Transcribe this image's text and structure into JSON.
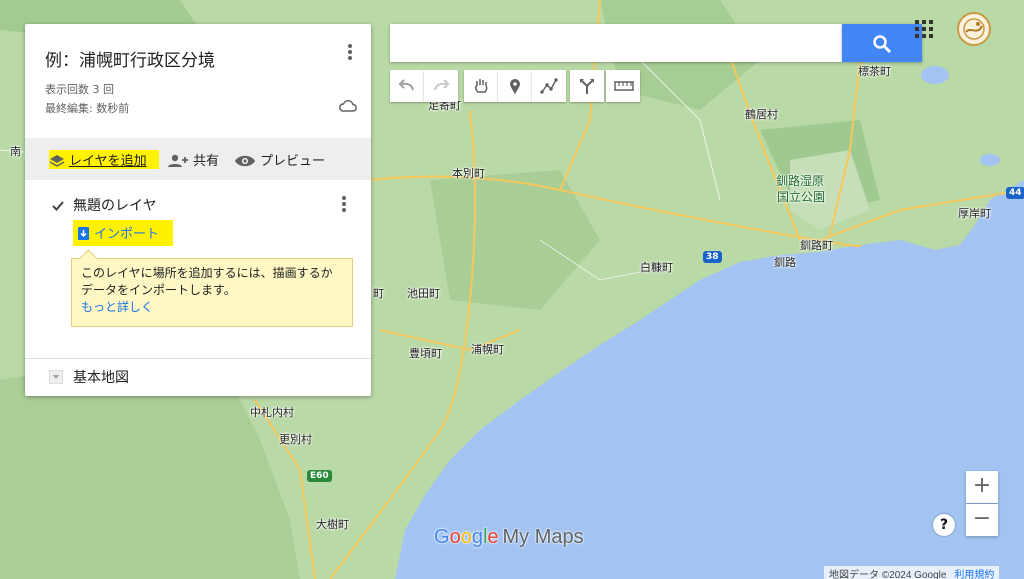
{
  "colors": {
    "sea": "#a3c4f3",
    "land": "#b9d9a6",
    "forest": "#9fcb8e",
    "road": "#f6c75a",
    "accent": "#4285f4",
    "highlight": "#fff200"
  },
  "map": {
    "places": [
      "標茶町",
      "鶴居村",
      "釧路湿原",
      "国立公園",
      "厚岸町",
      "釧路町",
      "釧路",
      "白糠町",
      "本別町",
      "足寄町",
      "池田町",
      "豊頃町",
      "浦幌町",
      "中札内村",
      "更別村",
      "大樹町",
      "南",
      "町"
    ],
    "route_shields": [
      "44",
      "38",
      "E60"
    ]
  },
  "panel": {
    "title": "例：浦幌町行政区分境",
    "views": "表示回数 3 回",
    "edited": "最終編集: 数秒前",
    "actions": {
      "add_layer": "レイヤを追加",
      "share": "共有",
      "preview": "プレビュー"
    },
    "layer": {
      "name": "無題のレイヤ",
      "checked": true,
      "import_label": "インポート"
    },
    "tip": {
      "text": "このレイヤに場所を追加するには、描画するかデータをインポートします。",
      "link": "もっと詳しく"
    },
    "basemap": "基本地図"
  },
  "search": {
    "placeholder": ""
  },
  "toolbar": {
    "icons": [
      "undo-icon",
      "redo-icon",
      "hand-icon",
      "marker-icon",
      "draw-line-icon",
      "directions-icon",
      "ruler-icon"
    ]
  },
  "zoom": {
    "in": "+",
    "out": "−"
  },
  "help": "?",
  "branding": {
    "g1": "G",
    "g2": "o",
    "g3": "o",
    "g4": "g",
    "g5": "l",
    "g6": "e",
    "product": "My Maps"
  },
  "attribution": {
    "data": "地図データ ©2024 Google",
    "terms": "利用規約"
  }
}
